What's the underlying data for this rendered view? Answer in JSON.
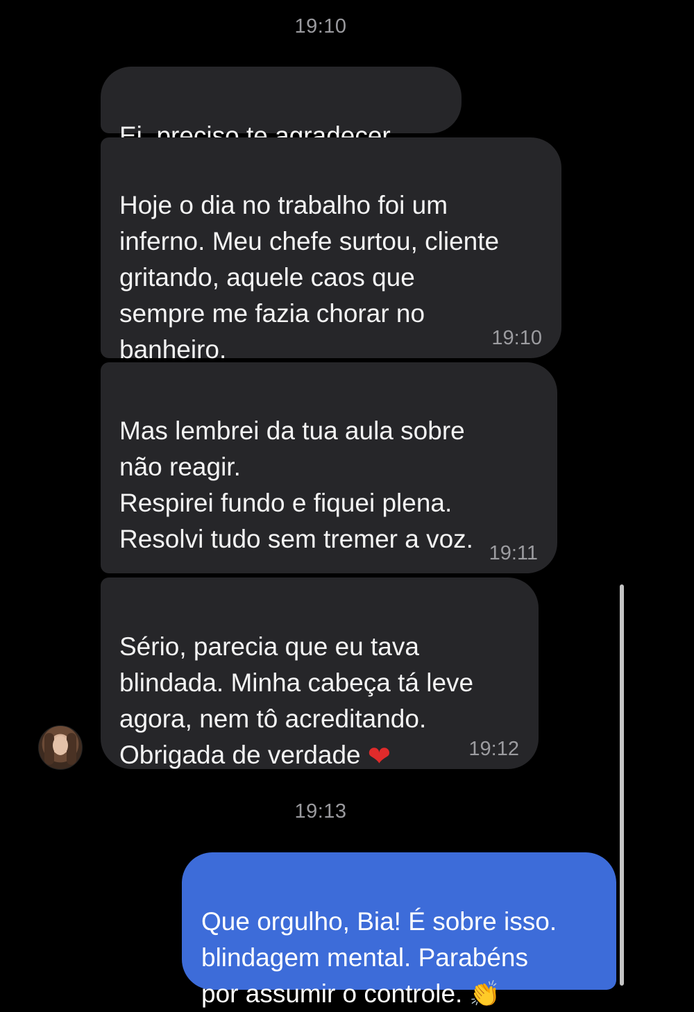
{
  "conversation": {
    "timestamps": [
      "19:10",
      "19:13"
    ],
    "incoming": [
      {
        "text": "Ei, preciso te agradecer..."
      },
      {
        "text": "Hoje o dia no trabalho foi um\ninferno. Meu chefe surtou, cliente\ngritando, aquele caos que\nsempre me fazia chorar no\nbanheiro.",
        "time": "19:10"
      },
      {
        "text": "Mas lembrei da tua aula sobre\nnão reagir.\nRespirei fundo e fiquei plena.\nResolvi tudo sem tremer a voz.",
        "time": "19:11"
      },
      {
        "text": "Sério, parecia que eu tava\nblindada. Minha cabeça tá leve\nagora, nem tô acreditando.\nObrigada de verdade",
        "emoji": "❤",
        "time": "19:12"
      }
    ],
    "outgoing": [
      {
        "text": "Que orgulho, Bia! É sobre isso.\nblindagem mental. Parabéns\npor assumir o controle.",
        "emoji": "👏"
      }
    ]
  },
  "colors": {
    "background": "#000000",
    "incoming_bubble": "#262629",
    "outgoing_bubble": "#3d6cd9",
    "timestamp": "#9a9a9e"
  },
  "icons": {
    "heart": "red-heart-emoji",
    "clap": "clapping-hands-emoji"
  }
}
